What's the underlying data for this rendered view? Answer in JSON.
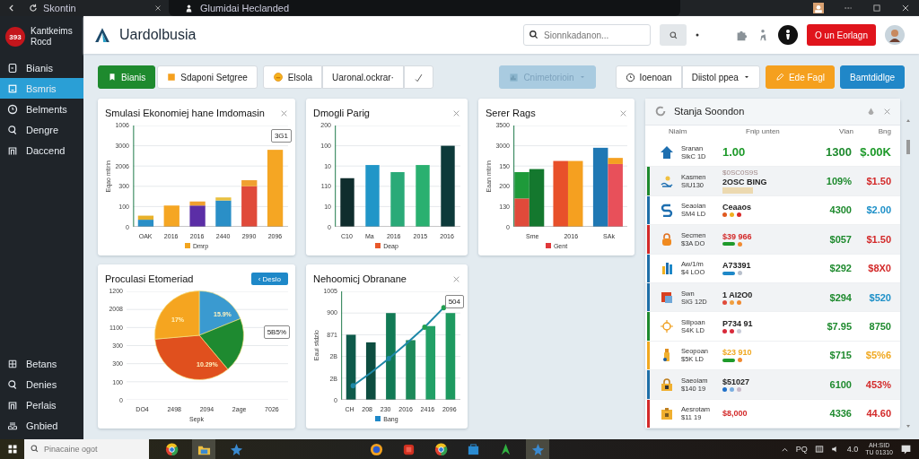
{
  "browser": {
    "tab": "Skontin",
    "address_tab": "Glumidai Heclanded"
  },
  "sidebar": {
    "badge": "393",
    "brand": "Kantkeims Rocd",
    "items": [
      {
        "label": "Bianis",
        "selected": false
      },
      {
        "label": "Bsmris",
        "selected": true
      },
      {
        "label": "Belments",
        "selected": false
      },
      {
        "label": "Dengre",
        "selected": false
      },
      {
        "label": "Daccend",
        "selected": false
      }
    ],
    "bottom_items": [
      {
        "label": "Betans",
        "selected": false
      },
      {
        "label": "Denies",
        "selected": false
      },
      {
        "label": "Perlais",
        "selected": false
      },
      {
        "label": "Gnbied",
        "selected": false
      }
    ]
  },
  "header": {
    "title": "Uardolbusia",
    "search": {
      "placeholder": "Sionnkadanon..."
    },
    "button": "O un Eorlagn"
  },
  "toolbar": {
    "left": [
      {
        "label": "Bianis",
        "kind": "primary"
      },
      {
        "label": "Sdaponi Setgree",
        "kind": "plain"
      }
    ],
    "segment": [
      {
        "label": "Elsola",
        "kind": "coin"
      },
      {
        "label": "Uaronal.ockrar·",
        "kind": "text"
      },
      {
        "kind": "check"
      }
    ],
    "right": [
      {
        "label": "Cnimetorioin",
        "kind": "dropdown",
        "disabled": true
      },
      {
        "label": "Ioenoan",
        "kind": "clock",
        "disabled": false
      },
      {
        "label": "Diistol ppea",
        "kind": "dropdown",
        "disabled": false
      },
      {
        "label": "Ede Fagl",
        "kind": "warning",
        "disabled": false
      },
      {
        "label": "Bamtdidlge",
        "kind": "info",
        "disabled": false
      }
    ]
  },
  "charts": [
    {
      "kind": "stacked",
      "title": "Smulasi Ekonomiej hane Imdomasin",
      "action": {
        "kind": "close"
      },
      "badge": "3G1",
      "ylabel": "Eqao mtirin",
      "yticks": [
        "1006",
        "3000",
        "2006",
        "300",
        "100",
        "0"
      ],
      "xticks": [
        "OAK",
        "2016",
        "2016",
        "2440",
        "2990",
        "2096"
      ],
      "legend": {
        "text": "Dmrp",
        "color": "#f2a51f"
      }
    },
    {
      "kind": "bar",
      "title": "Dmogli Parig",
      "action": {
        "kind": "close"
      },
      "yticks": [
        "200",
        "100",
        "10",
        "110",
        "10",
        "0"
      ],
      "xticks": [
        "C10",
        "Ma",
        "2016",
        "2015",
        "2016"
      ],
      "legend": {
        "text": "Deap",
        "color": "#e8582a"
      }
    },
    {
      "kind": "grouped",
      "title": "Serer Rags",
      "action": {
        "kind": "close"
      },
      "ylabel": "Eaan mtirin",
      "yticks": [
        "3500",
        "3000",
        "150",
        "200",
        "130",
        "0"
      ],
      "xticks": [
        "Sme",
        "2016",
        "SAk"
      ],
      "legend": {
        "text": "Gent",
        "color": "#e0383a"
      }
    },
    {
      "kind": "pie",
      "title": "Proculasi Etomeriad",
      "action": {
        "kind": "button",
        "label": "‹ Deslo"
      },
      "badge": "5B5%",
      "yticks": [
        "1200",
        "2008",
        "1100",
        "300",
        "300",
        "100",
        "0"
      ],
      "xticks": [
        "DO4",
        "2498",
        "2094",
        "2age",
        "7026"
      ],
      "xlabel": "Sepk",
      "slice_labels": [
        "15.9%",
        "17%",
        "10.29%"
      ]
    },
    {
      "kind": "combo",
      "title": "Nehoomicj Obranane",
      "action": {
        "kind": "close"
      },
      "badge": "504",
      "ylabel": "Eaui stdzlo",
      "yticks": [
        "1005",
        "900",
        "871",
        "2B",
        "2B",
        "0"
      ],
      "xticks": [
        "CH",
        "208",
        "230",
        "2016",
        "2416",
        "2096"
      ],
      "legend": {
        "text": "Bang",
        "color": "#1e88c8"
      }
    }
  ],
  "panel": {
    "title": "Stanja Soondon",
    "columns": [
      "Nialm",
      "Fnip unten",
      "Vlan",
      "Bng"
    ],
    "rows": [
      {
        "name": "Sranan",
        "sub": "SlkC 1D",
        "code": {
          "text": "1.00",
          "color": "#1e9a2a"
        },
        "value": {
          "text": "1300",
          "color": "#1e8a2e"
        },
        "change": {
          "text": "$.00K",
          "color": "#1e9a2a"
        },
        "highlighted": false
      },
      {
        "name": "Kasmen",
        "sub": "SIU130",
        "code_note": "$0SC0S9S",
        "code": {
          "text": "2OSC BING",
          "color": "#222222"
        },
        "marks": [
          {
            "kind": "tag",
            "color": "#ecd9b0"
          }
        ],
        "value": {
          "text": "109%",
          "color": "#1e8a2e"
        },
        "change": {
          "text": "$1.50",
          "color": "#d32a2a"
        },
        "color": "#1e8a2e",
        "highlighted": true
      },
      {
        "name": "Seaoian",
        "sub": "SM4 LD",
        "code": {
          "text": "Ceaaos",
          "color": "#222222"
        },
        "marks": [
          {
            "kind": "dot",
            "color": "#e05a20"
          },
          {
            "kind": "dot",
            "color": "#f0b020"
          },
          {
            "kind": "dot",
            "color": "#d82a2a"
          }
        ],
        "value": {
          "text": "4300",
          "color": "#1e8a2e"
        },
        "change": {
          "text": "$2.00",
          "color": "#1e90c8"
        },
        "color": "#1f6fa8",
        "highlighted": false
      },
      {
        "name": "Secmen",
        "sub": "$3A DO",
        "code": {
          "text": "$39 966",
          "color": "#d32a2a"
        },
        "marks": [
          {
            "kind": "bar",
            "color": "#1e9a2a"
          },
          {
            "kind": "dot",
            "color": "#f08a30"
          }
        ],
        "value": {
          "text": "$057",
          "color": "#1e8a2e"
        },
        "change": {
          "text": "$1.50",
          "color": "#d32a2a"
        },
        "color": "#d32a2a",
        "highlighted": true
      },
      {
        "name": "Aw/1/m",
        "sub": "$4 LOO",
        "code": {
          "text": "A73391",
          "color": "#222222"
        },
        "marks": [
          {
            "kind": "bar",
            "color": "#1e88c8"
          },
          {
            "kind": "dot",
            "color": "#b8c0cc"
          }
        ],
        "value": {
          "text": "$292",
          "color": "#1e8a2e"
        },
        "change": {
          "text": "$8X0",
          "color": "#d32a2a"
        },
        "color": "#1f6fa8",
        "highlighted": false
      },
      {
        "name": "Swn",
        "sub": "SIG 12D",
        "code": {
          "text": "1 AI2O0",
          "color": "#222222"
        },
        "marks": [
          {
            "kind": "dot",
            "color": "#e04a3a"
          },
          {
            "kind": "dot",
            "color": "#f0a040"
          },
          {
            "kind": "dot",
            "color": "#f08a30"
          }
        ],
        "value": {
          "text": "$294",
          "color": "#1e8a2e"
        },
        "change": {
          "text": "$520",
          "color": "#1e90c8"
        },
        "color": "#1f6fa8",
        "highlighted": true
      },
      {
        "name": "Silipoan",
        "sub": "S4K LD",
        "code": {
          "text": "P734 91",
          "color": "#222222"
        },
        "marks": [
          {
            "kind": "dot",
            "color": "#d82a3a"
          },
          {
            "kind": "dot",
            "color": "#d82a3a"
          },
          {
            "kind": "dot",
            "color": "#c8ccd8"
          }
        ],
        "value": {
          "text": "$7.95",
          "color": "#1e8a2e"
        },
        "change": {
          "text": "8750",
          "color": "#1e8a2e"
        },
        "color": "#1e8a2e",
        "highlighted": false
      },
      {
        "name": "Seopoan",
        "sub": "$5K LD",
        "code": {
          "text": "$23 910",
          "color": "#f0a820"
        },
        "marks": [
          {
            "kind": "bar",
            "color": "#1e9a2a"
          },
          {
            "kind": "dot",
            "color": "#f08a30"
          }
        ],
        "value": {
          "text": "$715",
          "color": "#1e8a2e"
        },
        "change": {
          "text": "$5%6",
          "color": "#f0a820"
        },
        "color": "#f0a820",
        "highlighted": false
      },
      {
        "name": "Saeoiam",
        "sub": "$140 19",
        "code": {
          "text": "$51027",
          "color": "#222222"
        },
        "marks": [
          {
            "kind": "dot",
            "color": "#1e6fc8"
          },
          {
            "kind": "dot",
            "color": "#7aaee0"
          },
          {
            "kind": "dot",
            "color": "#c8b8c8"
          }
        ],
        "value": {
          "text": "6100",
          "color": "#1e8a2e"
        },
        "change": {
          "text": "453%",
          "color": "#d32a2a"
        },
        "color": "#1f6fa8",
        "highlighted": true
      },
      {
        "name": "Aesrotam",
        "sub": "$11 19",
        "code": {
          "text": "$8,000",
          "color": "#d32a2a"
        },
        "value": {
          "text": "4336",
          "color": "#1e8a2e"
        },
        "change": {
          "text": "44.60",
          "color": "#d32a2a"
        },
        "color": "#d32a2a",
        "highlighted": false
      }
    ]
  },
  "taskbar": {
    "search": {
      "placeholder": "Pinacaine ogot"
    },
    "apps": [
      {
        "selected": false
      },
      {
        "selected": true
      },
      {
        "selected": false
      },
      {
        "selected": false
      },
      {
        "selected": false
      },
      {
        "selected": false
      },
      {
        "selected": false
      },
      {
        "selected": false
      },
      {
        "selected": true
      }
    ],
    "tray": {
      "ime": "PQ",
      "volume": "4.0",
      "time": "AH:SID",
      "date": "TU 01310"
    }
  }
}
